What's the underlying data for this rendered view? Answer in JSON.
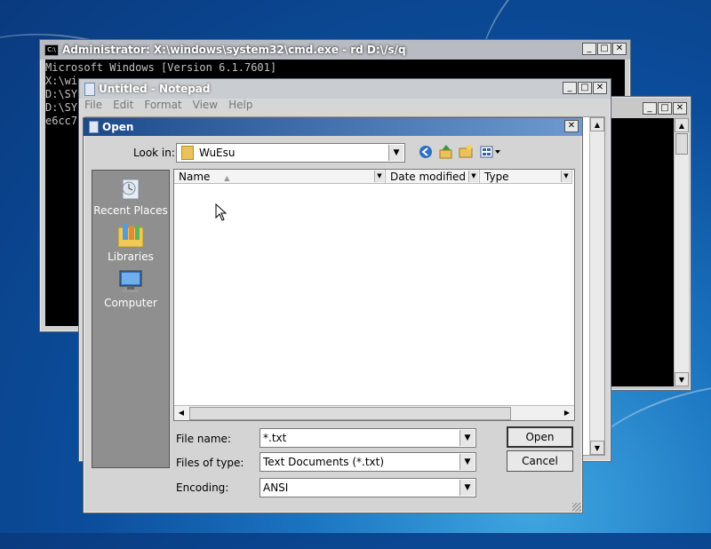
{
  "cmd_window": {
    "title": "Administrator: X:\\windows\\system32\\cmd.exe - rd  D:\\/s/q",
    "lines": [
      "Microsoft Windows [Version 6.1.7601]",
      "",
      "X:\\wi",
      "D:\\SY",
      "D:\\SY",
      "e6cc7"
    ]
  },
  "notepad": {
    "title": "Untitled - Notepad",
    "menu": [
      "File",
      "Edit",
      "Format",
      "View",
      "Help"
    ]
  },
  "open_dialog": {
    "title": "Open",
    "look_in_label": "Look in:",
    "look_in_value": "WuEsu",
    "places": [
      {
        "label": "Recent Places",
        "icon": "recent-places-icon"
      },
      {
        "label": "Libraries",
        "icon": "libraries-icon"
      },
      {
        "label": "Computer",
        "icon": "computer-icon"
      }
    ],
    "columns": [
      "Name",
      "Date modified",
      "Type"
    ],
    "file_name_label": "File name:",
    "file_name_value": "*.txt",
    "files_of_type_label": "Files of type:",
    "files_of_type_value": "Text Documents (*.txt)",
    "encoding_label": "Encoding:",
    "encoding_value": "ANSI",
    "open_button": "Open",
    "cancel_button": "Cancel"
  },
  "window_controls": {
    "minimize": "_",
    "maximize": "□",
    "close": "✕"
  }
}
